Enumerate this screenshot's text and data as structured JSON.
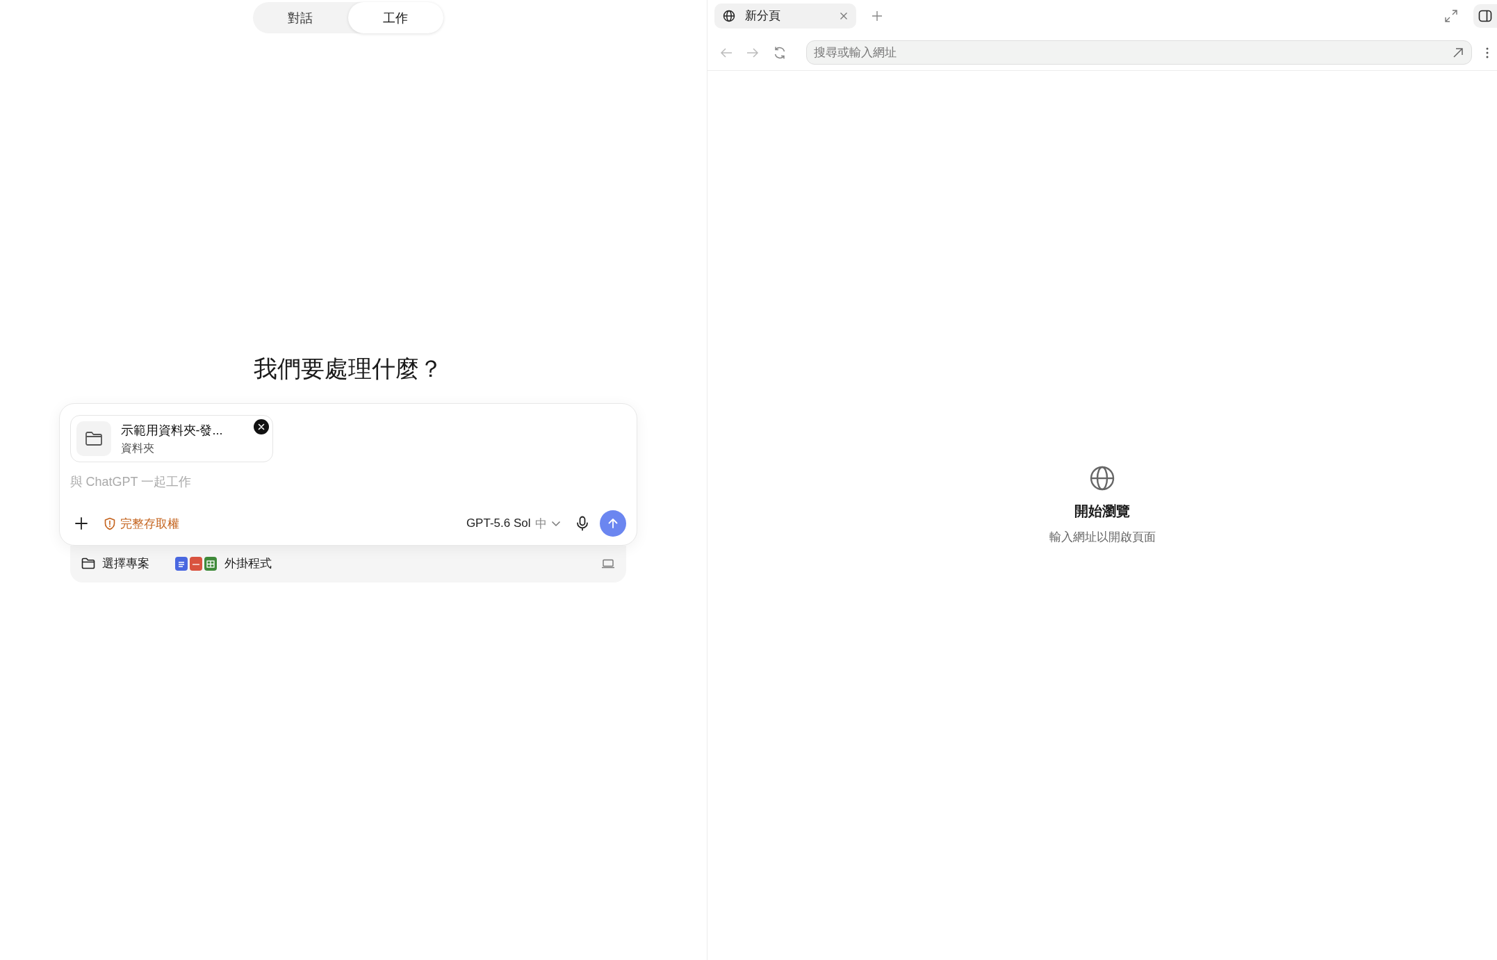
{
  "mode_tabs": [
    {
      "label": "對話",
      "selected": false
    },
    {
      "label": "工作",
      "selected": true
    }
  ],
  "composer": {
    "heading": "我們要處理什麼？",
    "attachment": {
      "name": "示範用資料夾-發...",
      "type": "資料夾"
    },
    "placeholder": "與 ChatGPT 一起工作",
    "access": "完整存取權",
    "model": "GPT-5.6 Sol",
    "effort": "中"
  },
  "footer": {
    "project": "選擇專案",
    "plugins": "外掛程式"
  },
  "browser": {
    "tabs": [
      {
        "title": "新分頁",
        "selected": true
      }
    ],
    "address": {
      "placeholder": "搜尋或輸入網址"
    },
    "empty": {
      "title": "開始瀏覽",
      "subtitle": "輸入網址以開啟頁面"
    }
  }
}
